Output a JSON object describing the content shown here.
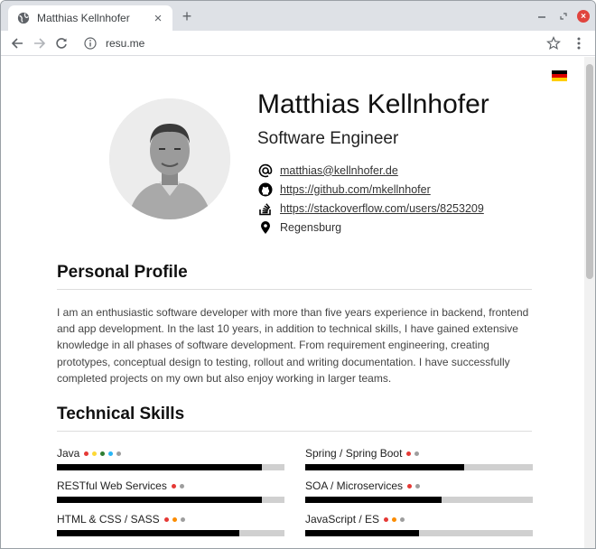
{
  "browser": {
    "tab_title": "Matthias Kellnhofer",
    "new_tab_label": "+",
    "url": "resu.me"
  },
  "profile": {
    "name": "Matthias Kellnhofer",
    "role": "Software Engineer",
    "contacts": [
      {
        "icon": "at-icon",
        "text": "matthias@kellnhofer.de",
        "link": true
      },
      {
        "icon": "github-icon",
        "text": "https://github.com/mkellnhofer",
        "link": true
      },
      {
        "icon": "stackoverflow-icon",
        "text": "https://stackoverflow.com/users/8253209",
        "link": true
      },
      {
        "icon": "location-icon",
        "text": "Regensburg",
        "link": false
      }
    ],
    "language_flag": "german-flag-icon"
  },
  "sections": {
    "personal_profile_title": "Personal Profile",
    "personal_profile_text": "I am an enthusiastic software developer with more than five years experience in backend, frontend and app development. In the last 10 years, in addition to technical skills, I have gained extensive knowledge in all phases of software development. From requirement engineering, creating prototypes, conceptual design to testing, rollout and writing documentation. I have successfully completed projects on my own but also enjoy working in larger teams.",
    "technical_skills_title": "Technical Skills"
  },
  "skills": [
    {
      "label": "Java",
      "level": 0.9,
      "dots": [
        "#e53935",
        "#fdd835",
        "#2e7d32",
        "#29b6f6",
        "#9e9e9e"
      ]
    },
    {
      "label": "Spring / Spring Boot",
      "level": 0.7,
      "dots": [
        "#e53935",
        "#9e9e9e"
      ]
    },
    {
      "label": "RESTful Web Services",
      "level": 0.9,
      "dots": [
        "#e53935",
        "#9e9e9e"
      ]
    },
    {
      "label": "SOA / Microservices",
      "level": 0.6,
      "dots": [
        "#e53935",
        "#9e9e9e"
      ]
    },
    {
      "label": "HTML & CSS / SASS",
      "level": 0.8,
      "dots": [
        "#e53935",
        "#fb8c00",
        "#9e9e9e"
      ]
    },
    {
      "label": "JavaScript / ES",
      "level": 0.5,
      "dots": [
        "#e53935",
        "#fb8c00",
        "#9e9e9e"
      ]
    }
  ]
}
